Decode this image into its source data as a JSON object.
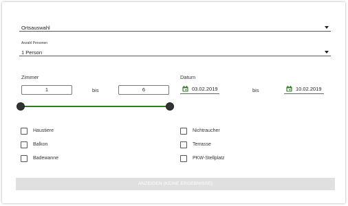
{
  "location": {
    "label": "Ortsauswahl"
  },
  "persons": {
    "label": "Anzahl Personen",
    "value": "1 Person"
  },
  "rooms": {
    "label": "Zimmer",
    "min": "1",
    "max": "6",
    "separator": "bis",
    "range_fraction": [
      0,
      1
    ]
  },
  "date": {
    "label": "Datum",
    "from": "03.02.2019",
    "to": "10.02.2019",
    "separator": "bis"
  },
  "amenities": [
    {
      "label": "Haustiere",
      "checked": false
    },
    {
      "label": "Nichtraucher",
      "checked": false
    },
    {
      "label": "Balkon",
      "checked": false
    },
    {
      "label": "Terrasse",
      "checked": false
    },
    {
      "label": "Badewanne",
      "checked": false
    },
    {
      "label": "PKW-Stellplatz",
      "checked": false
    }
  ],
  "submit": {
    "label": "ANZEIGEN (KEINE ERGEBNISSE)"
  },
  "colors": {
    "accent": "#2e7d1e",
    "knob": "#333333",
    "button_bg": "#e0e0e0"
  },
  "icons": {
    "dropdown": "caret-down-icon",
    "calendar": "calendar-icon"
  }
}
